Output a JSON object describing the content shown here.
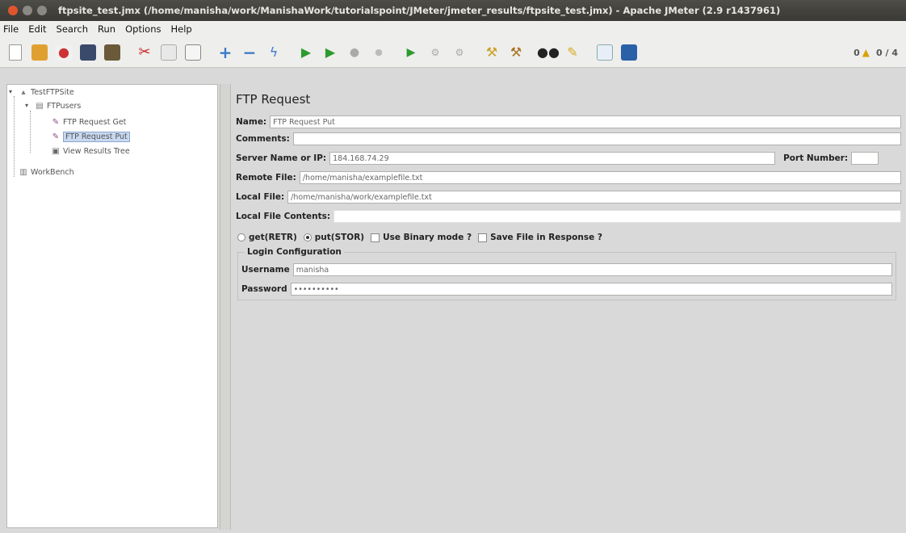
{
  "window": {
    "title": "ftpsite_test.jmx (/home/manisha/work/ManishaWork/tutorialspoint/JMeter/jmeter_results/ftpsite_test.jmx) - Apache JMeter (2.9 r1437961)"
  },
  "menubar": {
    "items": [
      "File",
      "Edit",
      "Search",
      "Run",
      "Options",
      "Help"
    ]
  },
  "toolbar": {
    "warn_count": "0",
    "threads": "0 / 4"
  },
  "tree": {
    "root": "TestFTPSite",
    "group": "FTPusers",
    "get": "FTP Request Get",
    "put": "FTP Request Put",
    "results": "View Results Tree",
    "workbench": "WorkBench"
  },
  "panel": {
    "title": "FTP Request",
    "name_label": "Name:",
    "name_value": "FTP Request Put",
    "comments_label": "Comments:",
    "server_label": "Server Name or IP:",
    "server_value": "184.168.74.29",
    "port_label": "Port Number:",
    "port_value": "",
    "remote_label": "Remote File:",
    "remote_value": "/home/manisha/examplefile.txt",
    "local_label": "Local File:",
    "local_value": "/home/manisha/work/examplefile.txt",
    "contents_label": "Local File Contents:",
    "opt_get": "get(RETR)",
    "opt_put": "put(STOR)",
    "opt_binary": "Use Binary mode ?",
    "opt_save": "Save File in Response ?",
    "login_title": "Login Configuration",
    "username_label": "Username",
    "username_value": "manisha",
    "password_label": "Password",
    "password_value": "••••••••••"
  }
}
